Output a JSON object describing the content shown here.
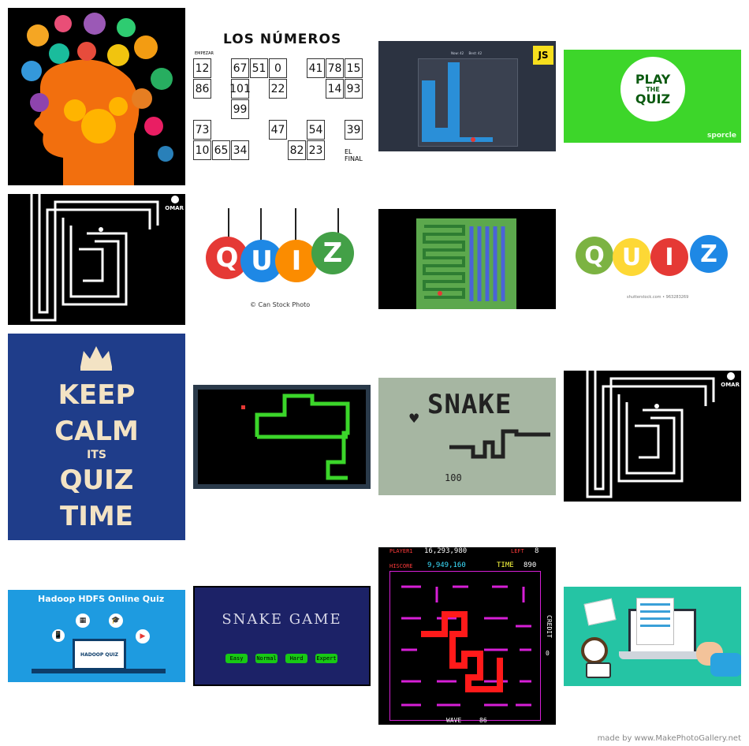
{
  "tiles": {
    "numeros": {
      "title": "LOS NÚMEROS",
      "cells": [
        "12",
        "67",
        "51",
        "0",
        "41",
        "78",
        "15",
        "86",
        "101",
        "22",
        "14",
        "93",
        "99",
        "73",
        "47",
        "54",
        "39",
        "10",
        "65",
        "34",
        "82",
        "23"
      ],
      "start_label": "EMPEZAR",
      "end_label": "EL FINAL"
    },
    "snake_js": {
      "score_text": "Now: 42     Best: 42",
      "badge": "JS"
    },
    "play_quiz": {
      "line1": "PLAY",
      "line2": "THE",
      "line3": "QUIZ",
      "brand": "sporcle"
    },
    "maze": {
      "logo": "OMAR"
    },
    "quiz_hanging": {
      "letters": [
        "Q",
        "U",
        "I",
        "Z"
      ],
      "credit": "© Can Stock Photo"
    },
    "quiz_doodle": {
      "letters": [
        "Q",
        "U",
        "I",
        "Z"
      ],
      "credit": "shutterstock.com • 963283269"
    },
    "keep_calm": {
      "line1": "KEEP",
      "line2": "CALM",
      "line3": "ITS",
      "line4": "QUIZ",
      "line5": "TIME"
    },
    "snake_lcd": {
      "title": "SNAKE",
      "score": "100"
    },
    "maze2": {
      "logo": "OMAR"
    },
    "hadoop": {
      "title": "Hadoop HDFS Online Quiz",
      "screen": "HADOOP QUIZ"
    },
    "snake_game": {
      "title": "SNAKE GAME",
      "buttons": [
        "Easy",
        "Normal",
        "Hard",
        "Expert"
      ]
    },
    "nibbler": {
      "player_label": "PLAYER1",
      "player_score": "16,293,980",
      "left_label": "LEFT",
      "left_value": "8",
      "hiscore_label": "HISCORE",
      "hiscore_value": "9,949,160",
      "time_label": "TIME",
      "time_value": "890",
      "credit_label": "CREDIT",
      "credit_value": "0",
      "wave_label": "WAVE",
      "wave_value": "86"
    }
  },
  "footer": "made by www.MakePhotoGallery.net"
}
